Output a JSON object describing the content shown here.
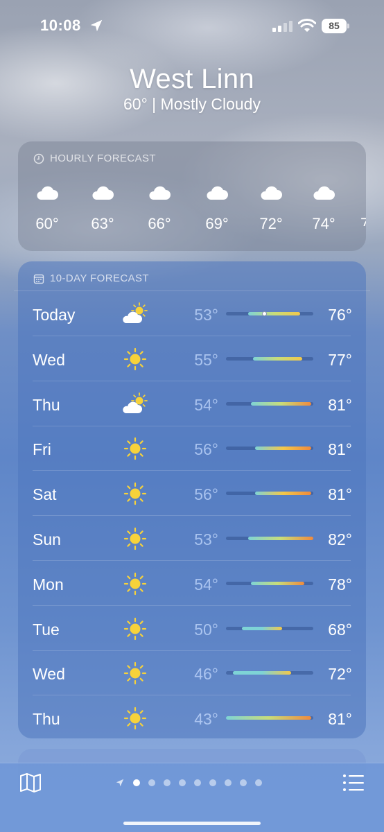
{
  "status_bar": {
    "time": "10:08",
    "battery": "85"
  },
  "header": {
    "city": "West Linn",
    "summary": "60°  |  Mostly Cloudy"
  },
  "hourly": {
    "title": "HOURLY FORECAST",
    "items": [
      {
        "icon": "cloud-icon",
        "temp": "60°"
      },
      {
        "icon": "cloud-icon",
        "temp": "63°"
      },
      {
        "icon": "cloud-icon",
        "temp": "66°"
      },
      {
        "icon": "cloud-icon",
        "temp": "69°"
      },
      {
        "icon": "cloud-icon",
        "temp": "72°"
      },
      {
        "icon": "cloud-icon",
        "temp": "74°"
      }
    ]
  },
  "ten_day": {
    "title": "10-DAY FORECAST",
    "range_min": 43,
    "range_max": 82,
    "days": [
      {
        "day": "Today",
        "icon": "partly-sunny-icon",
        "lo": "53°",
        "hi": "76°",
        "lo_val": 53,
        "hi_val": 76,
        "current": 60
      },
      {
        "day": "Wed",
        "icon": "sun-icon",
        "lo": "55°",
        "hi": "77°",
        "lo_val": 55,
        "hi_val": 77
      },
      {
        "day": "Thu",
        "icon": "partly-sunny-icon",
        "lo": "54°",
        "hi": "81°",
        "lo_val": 54,
        "hi_val": 81
      },
      {
        "day": "Fri",
        "icon": "sun-icon",
        "lo": "56°",
        "hi": "81°",
        "lo_val": 56,
        "hi_val": 81
      },
      {
        "day": "Sat",
        "icon": "sun-icon",
        "lo": "56°",
        "hi": "81°",
        "lo_val": 56,
        "hi_val": 81
      },
      {
        "day": "Sun",
        "icon": "sun-icon",
        "lo": "53°",
        "hi": "82°",
        "lo_val": 53,
        "hi_val": 82
      },
      {
        "day": "Mon",
        "icon": "sun-icon",
        "lo": "54°",
        "hi": "78°",
        "lo_val": 54,
        "hi_val": 78
      },
      {
        "day": "Tue",
        "icon": "sun-icon",
        "lo": "50°",
        "hi": "68°",
        "lo_val": 50,
        "hi_val": 68
      },
      {
        "day": "Wed",
        "icon": "sun-icon",
        "lo": "46°",
        "hi": "72°",
        "lo_val": 46,
        "hi_val": 72
      },
      {
        "day": "Thu",
        "icon": "sun-icon",
        "lo": "43°",
        "hi": "81°",
        "lo_val": 43,
        "hi_val": 81
      }
    ]
  },
  "pager": {
    "pages": 9,
    "active": 0
  },
  "colors": {
    "sun": "#f7d23a",
    "bar_cool": "#7ed3d6",
    "bar_mild": "#c8dd7a",
    "bar_warm": "#f3c84a",
    "bar_hot": "#f08a3c"
  }
}
